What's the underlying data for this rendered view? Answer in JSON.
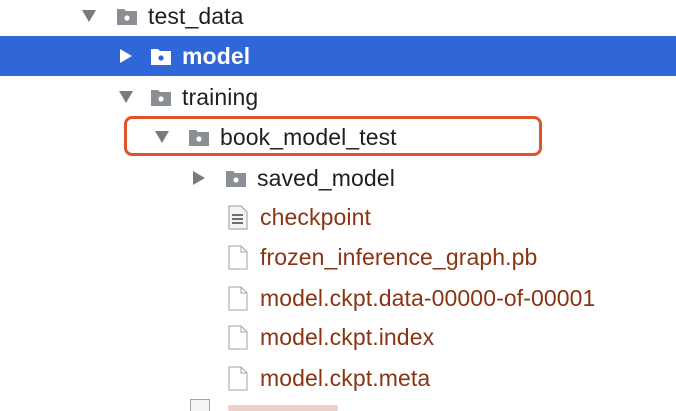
{
  "tree": {
    "items": [
      {
        "label": "test_data",
        "type": "folder",
        "expanded": true,
        "selected": false
      },
      {
        "label": "model",
        "type": "folder",
        "expanded": false,
        "selected": true
      },
      {
        "label": "training",
        "type": "folder",
        "expanded": true,
        "selected": false
      },
      {
        "label": "book_model_test",
        "type": "folder",
        "expanded": true,
        "selected": false,
        "highlighted": true
      },
      {
        "label": "saved_model",
        "type": "folder",
        "expanded": false,
        "selected": false
      },
      {
        "label": "checkpoint",
        "type": "text-file",
        "selected": false
      },
      {
        "label": "frozen_inference_graph.pb",
        "type": "file",
        "selected": false
      },
      {
        "label": "model.ckpt.data-00000-of-00001",
        "type": "file",
        "selected": false
      },
      {
        "label": "model.ckpt.index",
        "type": "file",
        "selected": false
      },
      {
        "label": "model.ckpt.meta",
        "type": "file",
        "selected": false
      }
    ]
  },
  "colors": {
    "selection": "#2f66d8",
    "file_text": "#8a3413",
    "highlight_border": "#e0532d",
    "folder_icon": "#8a8f96"
  }
}
